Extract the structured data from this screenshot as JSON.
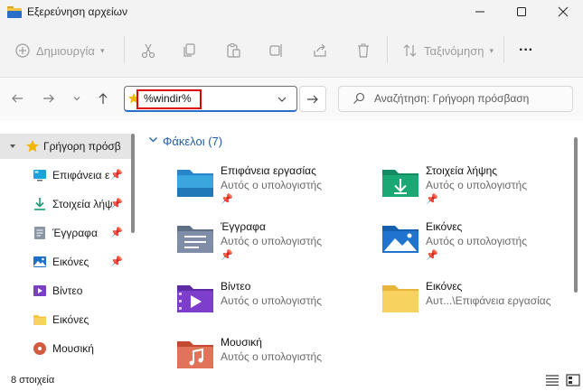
{
  "window": {
    "title": "Εξερεύνηση αρχείων"
  },
  "commandbar": {
    "new_label": "Δημιουργία",
    "sort_label": "Ταξινόμηση",
    "more_label": "···"
  },
  "address": {
    "value": "%windir%"
  },
  "search": {
    "placeholder": "Αναζήτηση: Γρήγορη πρόσβαση"
  },
  "sidebar": {
    "items": [
      {
        "label": "Γρήγορη πρόσβ",
        "icon": "star-icon",
        "pinned": false
      },
      {
        "label": "Επιφάνεια ε",
        "icon": "desktop-icon",
        "pinned": true
      },
      {
        "label": "Στοιχεία λήψ",
        "icon": "download-icon",
        "pinned": true
      },
      {
        "label": "Έγγραφα",
        "icon": "documents-icon",
        "pinned": true
      },
      {
        "label": "Εικόνες",
        "icon": "pictures-icon",
        "pinned": true
      },
      {
        "label": "Βίντεο",
        "icon": "videos-icon",
        "pinned": false
      },
      {
        "label": "Εικόνες",
        "icon": "folder-icon",
        "pinned": false
      },
      {
        "label": "Μουσική",
        "icon": "music-icon",
        "pinned": false
      }
    ]
  },
  "main": {
    "group_header": "Φάκελοι (7)",
    "folders": [
      {
        "name": "Επιφάνεια εργασίας",
        "location": "Αυτός ο υπολογιστής",
        "pinned": true,
        "icon": "desktop-folder-icon"
      },
      {
        "name": "Στοιχεία λήψης",
        "location": "Αυτός ο υπολογιστής",
        "pinned": true,
        "icon": "downloads-folder-icon"
      },
      {
        "name": "Έγγραφα",
        "location": "Αυτός ο υπολογιστής",
        "pinned": true,
        "icon": "documents-folder-icon"
      },
      {
        "name": "Εικόνες",
        "location": "Αυτός ο υπολογιστής",
        "pinned": true,
        "icon": "pictures-folder-icon"
      },
      {
        "name": "Βίντεο",
        "location": "Αυτός ο υπολογιστής",
        "pinned": false,
        "icon": "videos-folder-icon"
      },
      {
        "name": "Εικόνες",
        "location": "Αυτ...\\Επιφάνεια εργασίας",
        "pinned": false,
        "icon": "folder-icon"
      },
      {
        "name": "Μουσική",
        "location": "Αυτός ο υπολογιστής",
        "pinned": false,
        "icon": "music-folder-icon"
      }
    ]
  },
  "status": {
    "item_count": "8 στοιχεία"
  },
  "colors": {
    "accent": "#2a6ec9",
    "highlight_box": "#e10000",
    "group_header": "#1f5fa8",
    "folder_yellow": "#f4c542"
  }
}
